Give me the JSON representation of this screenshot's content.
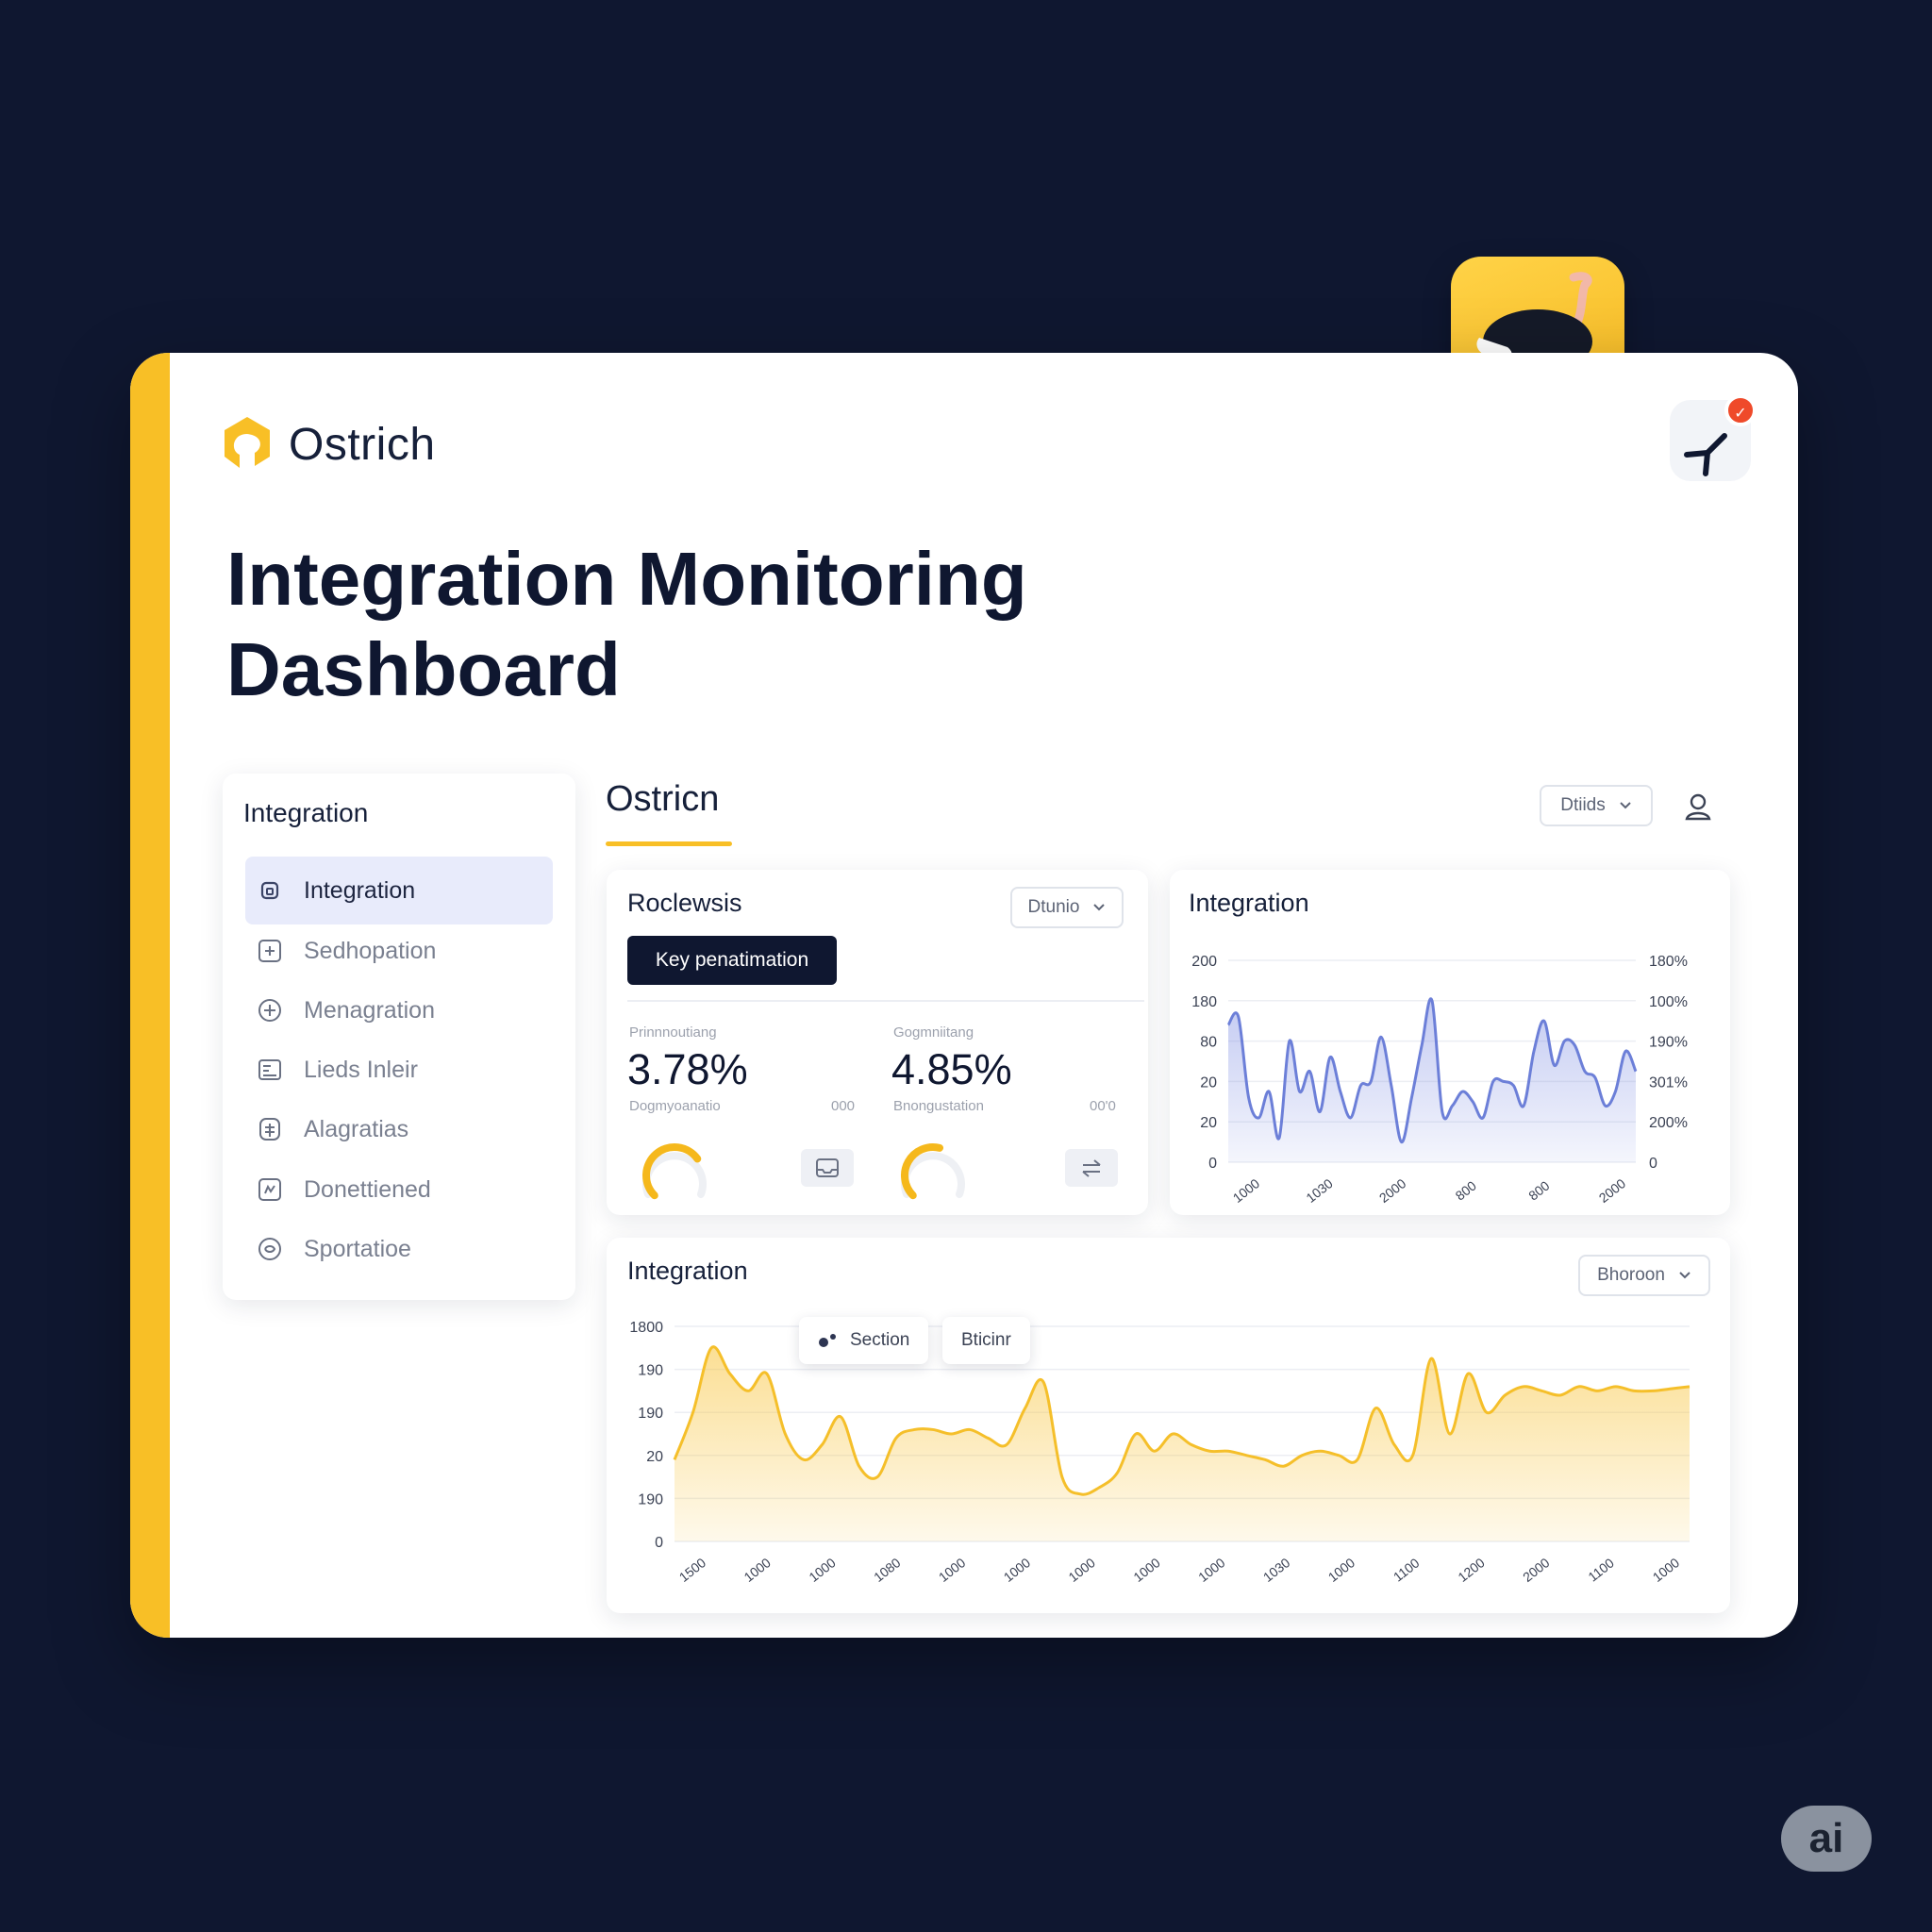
{
  "brand": {
    "name": "Ostrich",
    "accent": "#f8bf26",
    "dark": "#0f1730"
  },
  "page": {
    "title": "Integration Monitoring Dashboard"
  },
  "notifications": {
    "badge_icon": "check-icon"
  },
  "sidebar": {
    "title": "Integration",
    "items": [
      {
        "label": "Integration",
        "icon": "lock-icon",
        "active": true
      },
      {
        "label": "Sedhopation",
        "icon": "plus-square-icon"
      },
      {
        "label": "Menagration",
        "icon": "plus-circle-icon"
      },
      {
        "label": "Lieds Inleir",
        "icon": "list-icon"
      },
      {
        "label": "Alagratias",
        "icon": "grid-icon"
      },
      {
        "label": "Donettiened",
        "icon": "chart-icon"
      },
      {
        "label": "Sportatioe",
        "icon": "globe-icon"
      }
    ]
  },
  "main": {
    "title": "Ostricn",
    "header_dropdown": "Dtiids",
    "kpi_panel": {
      "title": "Roclewsis",
      "dropdown": "Dtunio",
      "key_button": "Key penatimation",
      "kpis": [
        {
          "label": "Prinnnoutiang",
          "value": "3.78%",
          "sublabel": "Dogmyoanatio",
          "tail": "000",
          "gauge": 0.7
        },
        {
          "label": "Gogmniitang",
          "value": "4.85%",
          "sublabel": "Bnongustation",
          "tail": "00'0",
          "gauge": 0.55
        }
      ]
    },
    "line_panel": {
      "title": "Integration"
    },
    "area_panel": {
      "title": "Integration",
      "dropdown": "Bhoroon",
      "legend": [
        {
          "label": "Section",
          "icon": "dots-icon"
        },
        {
          "label": "Bticinr"
        }
      ]
    }
  },
  "chart_data": [
    {
      "type": "area",
      "title": "Integration",
      "y_ticks_left": [
        "200",
        "180",
        "80",
        "20",
        "20",
        "0"
      ],
      "y_ticks_right": [
        "180%",
        "100%",
        "190%",
        "301%",
        "200%",
        "0"
      ],
      "x_ticks": [
        "1000",
        "1030",
        "2000",
        "800",
        "800",
        "2000"
      ],
      "x": [
        0,
        1,
        2,
        3,
        4,
        5,
        6,
        7,
        8,
        9,
        10,
        11,
        12,
        13,
        14,
        15,
        16,
        17,
        18,
        19,
        20,
        21,
        22,
        23,
        24,
        25,
        26,
        27,
        28,
        29,
        30,
        31,
        32,
        33,
        34,
        35,
        36,
        37,
        38,
        39,
        40
      ],
      "values": [
        0.68,
        0.72,
        0.32,
        0.22,
        0.35,
        0.12,
        0.6,
        0.35,
        0.45,
        0.25,
        0.52,
        0.35,
        0.22,
        0.38,
        0.4,
        0.62,
        0.38,
        0.1,
        0.32,
        0.58,
        0.8,
        0.25,
        0.28,
        0.35,
        0.3,
        0.22,
        0.4,
        0.4,
        0.38,
        0.28,
        0.55,
        0.7,
        0.48,
        0.6,
        0.58,
        0.45,
        0.42,
        0.28,
        0.35,
        0.55,
        0.45
      ],
      "ylim": [
        0,
        1
      ],
      "color": "#6c7fd8",
      "grid": true
    },
    {
      "type": "area",
      "title": "Integration",
      "y_ticks": [
        "1800",
        "190",
        "190",
        "20",
        "190",
        "0"
      ],
      "x_ticks": [
        "1500",
        "1000",
        "1000",
        "1080",
        "1000",
        "1000",
        "1000",
        "1000",
        "1000",
        "1030",
        "1000",
        "1100",
        "1200",
        "2000",
        "1100",
        "1000"
      ],
      "x": [
        0,
        1,
        2,
        3,
        4,
        5,
        6,
        7,
        8,
        9,
        10,
        11,
        12,
        13,
        14,
        15,
        16,
        17,
        18,
        19,
        20,
        21,
        22,
        23,
        24,
        25,
        26,
        27,
        28,
        29,
        30,
        31,
        32,
        33,
        34,
        35,
        36,
        37,
        38,
        39,
        40,
        41,
        42,
        43,
        44,
        45,
        46,
        47,
        48,
        49,
        50,
        51,
        52,
        53,
        54,
        55
      ],
      "values": [
        0.38,
        0.6,
        0.9,
        0.78,
        0.7,
        0.78,
        0.5,
        0.38,
        0.45,
        0.58,
        0.35,
        0.3,
        0.48,
        0.52,
        0.52,
        0.5,
        0.52,
        0.48,
        0.45,
        0.62,
        0.74,
        0.3,
        0.22,
        0.25,
        0.32,
        0.5,
        0.42,
        0.5,
        0.45,
        0.42,
        0.42,
        0.4,
        0.38,
        0.35,
        0.4,
        0.42,
        0.4,
        0.38,
        0.62,
        0.45,
        0.4,
        0.85,
        0.5,
        0.78,
        0.6,
        0.68,
        0.72,
        0.7,
        0.68,
        0.72,
        0.7,
        0.72,
        0.7,
        0.7,
        0.71,
        0.72
      ],
      "ylim": [
        0,
        1
      ],
      "color": "#f5bf2a",
      "grid": true
    }
  ]
}
